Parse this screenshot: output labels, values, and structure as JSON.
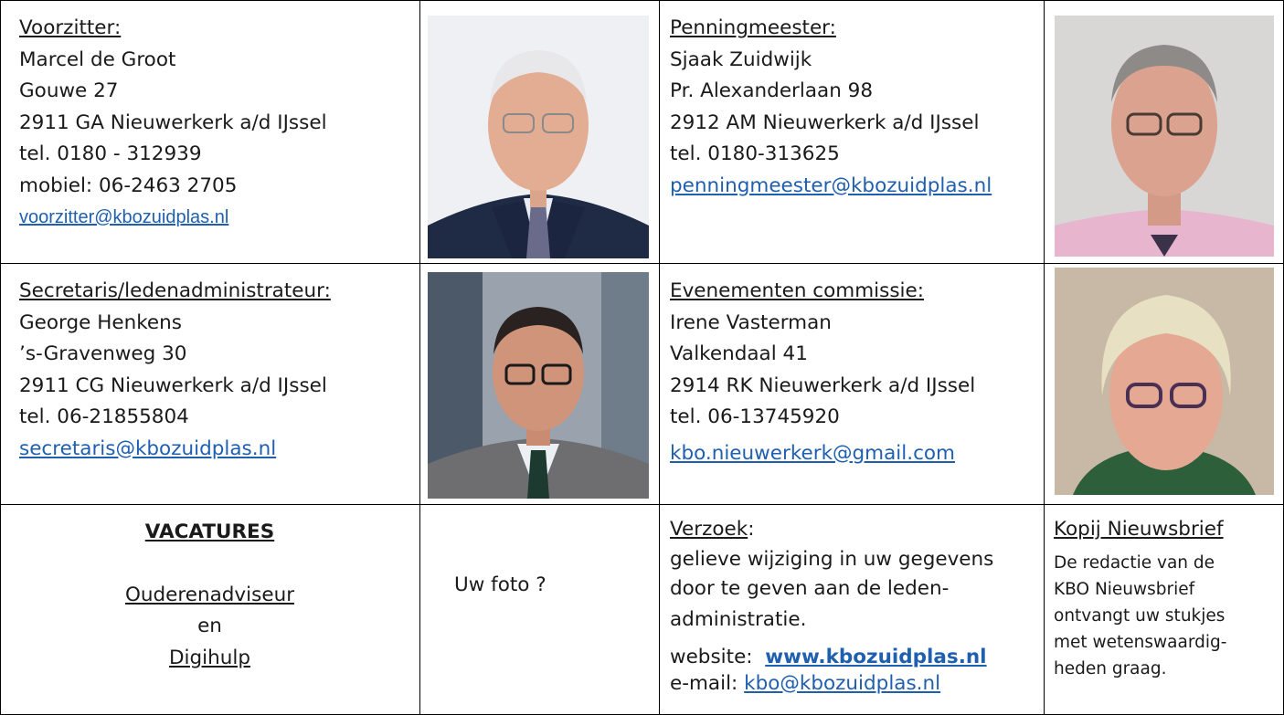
{
  "board": {
    "chair": {
      "role": "Voorzitter:",
      "name": "Marcel de Groot",
      "address": "Gouwe 27",
      "city": "2911 GA  Nieuwerkerk a/d IJssel",
      "phone": "tel. 0180 - 312939",
      "mobile": "mobiel: 06-2463 2705",
      "email": "voorzitter@kbozuidplas.nl"
    },
    "treasurer": {
      "role": "Penningmeester:",
      "name": "Sjaak Zuidwijk",
      "address": "Pr. Alexanderlaan 98",
      "city": "2912 AM  Nieuwerkerk a/d IJssel",
      "phone": "tel. 0180-313625",
      "email": "penningmeester@kbozuidplas.nl"
    },
    "secretary": {
      "role": "Secretaris/ledenadministrateur:",
      "name": "George Henkens",
      "address": "’s-Gravenweg 30",
      "city": "2911 CG  Nieuwerkerk a/d IJssel",
      "phone": "tel. 06-21855804",
      "email": "secretaris@kbozuidplas.nl"
    },
    "events": {
      "role": "Evenementen commissie:",
      "name": "Irene Vasterman",
      "address": "Valkendaal 41",
      "city": "2914 RK  Nieuwerkerk a/d IJssel",
      "phone": "tel. 06-13745920",
      "email": "kbo.nieuwerkerk@gmail.com"
    }
  },
  "vacancies": {
    "title": "VACATURES",
    "role1": "Ouderenadviseur",
    "conj": "en",
    "role2": "Digihulp"
  },
  "photo_placeholder": "Uw foto ?",
  "request": {
    "title": "Verzoek",
    "colon": ":",
    "line1": "gelieve wijziging in uw gegevens",
    "line2": "door te geven aan de leden-",
    "line3": "administratie.",
    "website_label": "website:",
    "website_url": "www.kbozuidplas.nl",
    "email_label": "e-mail:",
    "email": "kbo@kbozuidplas.nl"
  },
  "newsletter": {
    "title": "Kopij Nieuwsbrief",
    "line1": "De redactie van de",
    "line2": "KBO Nieuwsbrief",
    "line3": "ontvangt uw stukjes",
    "line4": "met wetenswaardig-",
    "line5": "heden graag."
  },
  "colors": {
    "link": "#1f5fb0",
    "border": "#000000"
  }
}
